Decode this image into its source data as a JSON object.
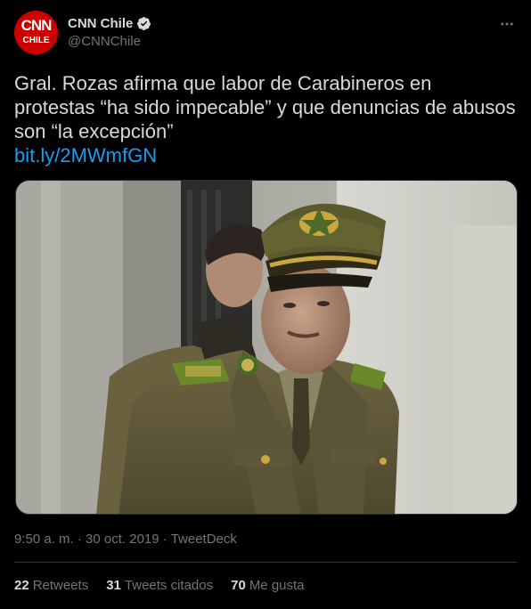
{
  "account": {
    "avatar_line1": "CNN",
    "avatar_line2": "CHILE",
    "display_name": "CNN Chile",
    "handle": "@CNNChile",
    "verified": true,
    "avatar_color": "#cc0000"
  },
  "tweet": {
    "text": "Gral. Rozas afirma que labor de Carabineros en protestas “ha sido impecable” y que denuncias de abusos son “la excepción”",
    "link": "bit.ly/2MWmfGN",
    "media_icon": "photo-of-carabineros-general"
  },
  "meta": {
    "time": "9:50 a. m.",
    "separator1": " · ",
    "date": "30 oct. 2019",
    "separator2": " · ",
    "source": "TweetDeck"
  },
  "stats": {
    "retweets_count": "22",
    "retweets_label": "Retweets",
    "quotes_count": "31",
    "quotes_label": "Tweets citados",
    "likes_count": "70",
    "likes_label": "Me gusta"
  },
  "colors": {
    "background": "#000000",
    "text": "#d9d9d9",
    "muted": "#6e767d",
    "link": "#1d9bf0",
    "divider": "#2f3336"
  },
  "icons": {
    "more": "more-horizontal-icon",
    "verified": "verified-badge-icon"
  }
}
